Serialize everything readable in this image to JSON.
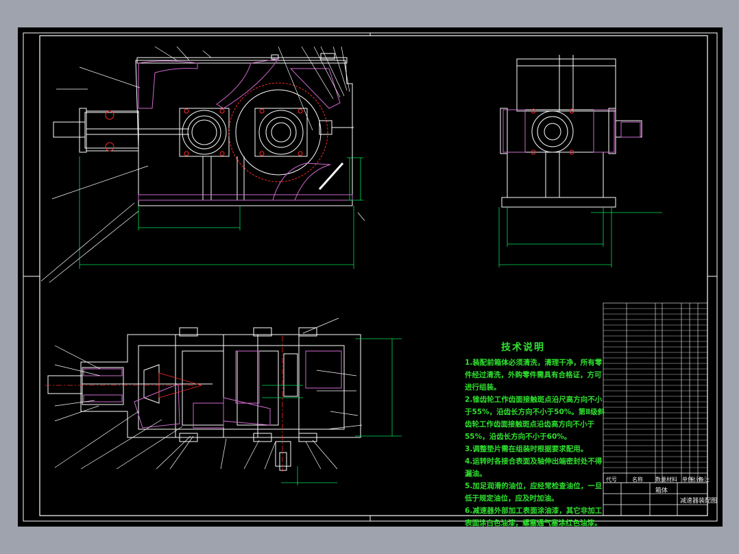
{
  "notes": {
    "title": "技术说明",
    "items": [
      "1.装配前箱体必须清洗，清理干净，所有零件经过清洗，外购零件需具有合格证，方可进行组装。",
      "2.锥齿轮工作齿面接触斑点沿尺高方向不小于55%，沿齿长方向不小于50%。第Ⅱ级斜齿轮工作齿面接触斑点沿齿高方向不小于55%，沿齿长方向不小于60%。",
      "3.调整垫片需在组装时根据要求配用。",
      "4.运转时各接合表面及轴伸出端密封处不得漏油。",
      "5.加足润滑的油位，应经常检查油位，一旦低于规定油位，应及时加油。",
      "6.减速器外部加工表面涂油漆，其它非加工表面涂白色油漆，螺塞通气塞涂红色油漆。"
    ]
  },
  "title_block": {
    "header": [
      "代号",
      "名称",
      "数量",
      "材料",
      "单件",
      "总计",
      "备注"
    ],
    "name": "减速器装配图",
    "part": "箱体"
  },
  "colors": {
    "frame": "#ffffff",
    "outline": "#ffffff",
    "dimension": "#00e05a",
    "hatch": "#d06ad0",
    "centerline": "#ff2a2a",
    "note": "#2fe12f"
  }
}
